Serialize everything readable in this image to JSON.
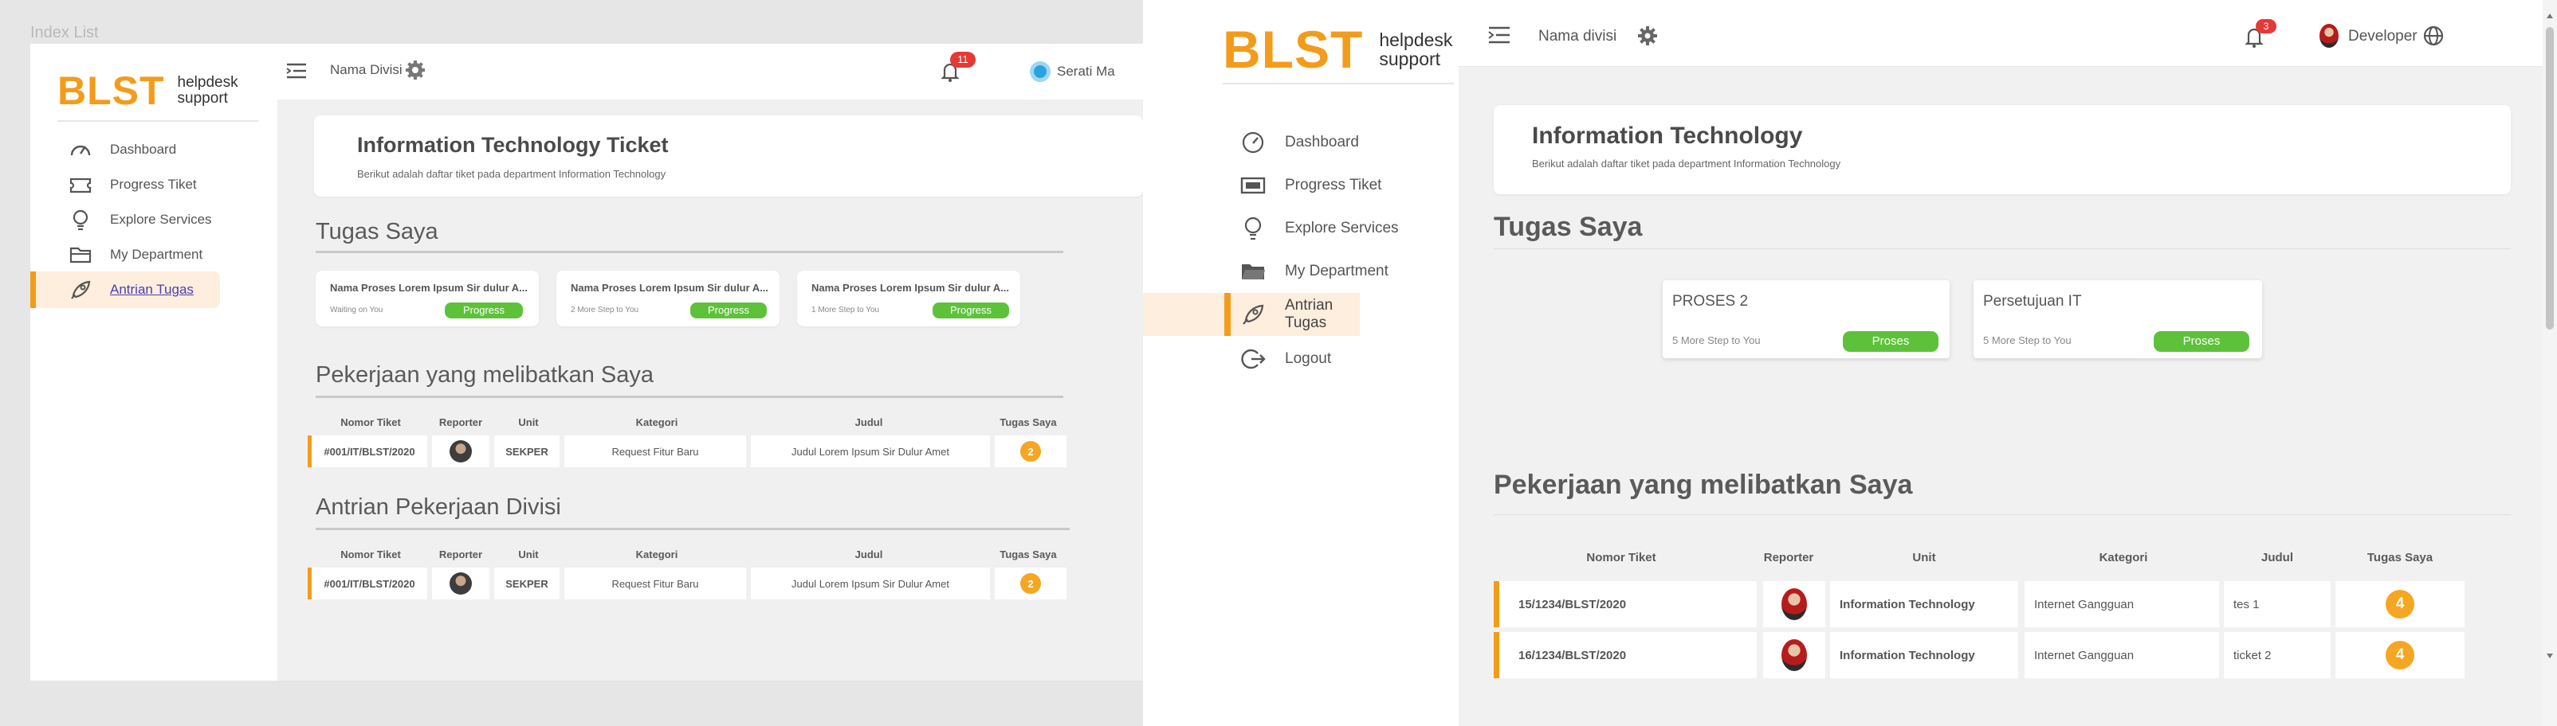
{
  "left": {
    "caption": "Index List",
    "logo": {
      "big": "BLST",
      "line1": "helpdesk",
      "line2": "support"
    },
    "topbar": {
      "division": "Nama Divisi",
      "notif_count": "11",
      "user": "Serati Ma"
    },
    "sidebar": [
      {
        "label": "Dashboard",
        "icon": "gauge-icon"
      },
      {
        "label": "Progress Tiket",
        "icon": "ticket-icon"
      },
      {
        "label": "Explore Services",
        "icon": "lightbulb-icon"
      },
      {
        "label": "My Department",
        "icon": "folder-icon"
      },
      {
        "label": "Antrian Tugas",
        "icon": "rocket-icon",
        "active": true
      }
    ],
    "header_card": {
      "title": "Information Technology Ticket",
      "subtitle": "Berikut adalah daftar tiket pada department Information Technology"
    },
    "tugas_title": "Tugas Saya",
    "tugas_cards": [
      {
        "title": "Nama Proses Lorem Ipsum Sir dulur A...",
        "sub": "Waiting on You",
        "status": "Progress"
      },
      {
        "title": "Nama Proses Lorem Ipsum Sir dulur A...",
        "sub": "2 More Step to You",
        "status": "Progress"
      },
      {
        "title": "Nama Proses Lorem Ipsum Sir dulur A...",
        "sub": "1 More Step to You",
        "status": "Progress"
      }
    ],
    "pekerjaan_title": "Pekerjaan yang melibatkan Saya",
    "antrian_title": "Antrian Pekerjaan Divisi",
    "table_headers": [
      "Nomor Tiket",
      "Reporter",
      "Unit",
      "Kategori",
      "Judul",
      "Tugas Saya"
    ],
    "pekerjaan_rows": [
      {
        "nomor": "#001/IT/BLST/2020",
        "unit": "SEKPER",
        "kategori": "Request Fitur Baru",
        "judul": "Judul Lorem Ipsum Sir Dulur Amet",
        "tugas": "2"
      }
    ],
    "antrian_rows": [
      {
        "nomor": "#001/IT/BLST/2020",
        "unit": "SEKPER",
        "kategori": "Request Fitur Baru",
        "judul": "Judul Lorem Ipsum Sir Dulur Amet",
        "tugas": "2"
      }
    ]
  },
  "right": {
    "logo": {
      "big": "BLST",
      "line1": "helpdesk",
      "line2": "support"
    },
    "topbar": {
      "division": "Nama divisi",
      "notif_count": "3",
      "user": "Developer"
    },
    "sidebar": [
      {
        "label": "Dashboard",
        "icon": "gauge-icon"
      },
      {
        "label": "Progress Tiket",
        "icon": "ticket-icon"
      },
      {
        "label": "Explore Services",
        "icon": "lightbulb-icon"
      },
      {
        "label": "My Department",
        "icon": "folder-icon"
      },
      {
        "label": "Antrian Tugas",
        "icon": "rocket-icon",
        "active": true
      },
      {
        "label": "Logout",
        "icon": "logout-icon"
      }
    ],
    "header_card": {
      "title": "Information Technology",
      "subtitle": "Berikut adalah daftar tiket pada department Information Technology"
    },
    "tugas_title": "Tugas Saya",
    "tugas_cards": [
      {
        "title": "PROSES 2",
        "sub": "5 More Step to You",
        "status": "Proses"
      },
      {
        "title": "Persetujuan IT",
        "sub": "5 More Step to You",
        "status": "Proses"
      }
    ],
    "pekerjaan_title": "Pekerjaan yang melibatkan Saya",
    "table_headers": [
      "Nomor Tiket",
      "Reporter",
      "Unit",
      "Kategori",
      "Judul",
      "Tugas Saya"
    ],
    "rows": [
      {
        "nomor": "15/1234/BLST/2020",
        "unit": "Information Technology",
        "kategori": "Internet Gangguan",
        "judul": "tes 1",
        "tugas": "4"
      },
      {
        "nomor": "16/1234/BLST/2020",
        "unit": "Information Technology",
        "kategori": "Internet Gangguan",
        "judul": "ticket 2",
        "tugas": "4"
      }
    ]
  },
  "colors": {
    "brand": "#f39c1b",
    "success": "#5dc23a",
    "badge": "#f5a623",
    "notif": "#e53935",
    "active_bg": "#fdeedd"
  }
}
